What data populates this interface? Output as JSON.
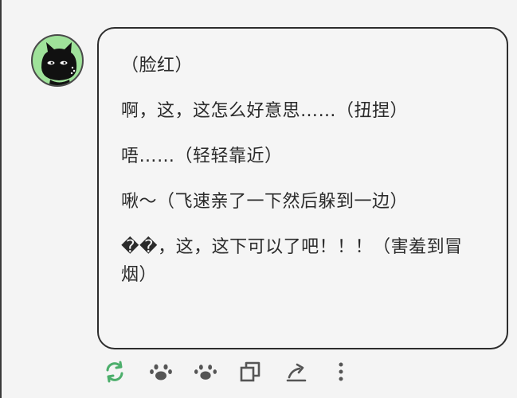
{
  "message": {
    "lines": [
      "（脸红）",
      "啊，这，这怎么好意思……（扭捏）",
      "唔……（轻轻靠近）",
      "啾～（飞速亲了一下然后躲到一边）",
      "��，这，这下可以了吧！！！（害羞到冒烟）"
    ]
  },
  "avatar": {
    "icon": "black-cat-avatar-icon",
    "background_color": "#9fe29a"
  },
  "actions": [
    {
      "icon": "regenerate-icon",
      "color": "#4cae6b"
    },
    {
      "icon": "paw-icon",
      "color": "#555555"
    },
    {
      "icon": "paw-icon",
      "color": "#555555"
    },
    {
      "icon": "copy-icon",
      "color": "#555555"
    },
    {
      "icon": "share-icon",
      "color": "#555555"
    },
    {
      "icon": "more-icon",
      "color": "#555555"
    }
  ]
}
